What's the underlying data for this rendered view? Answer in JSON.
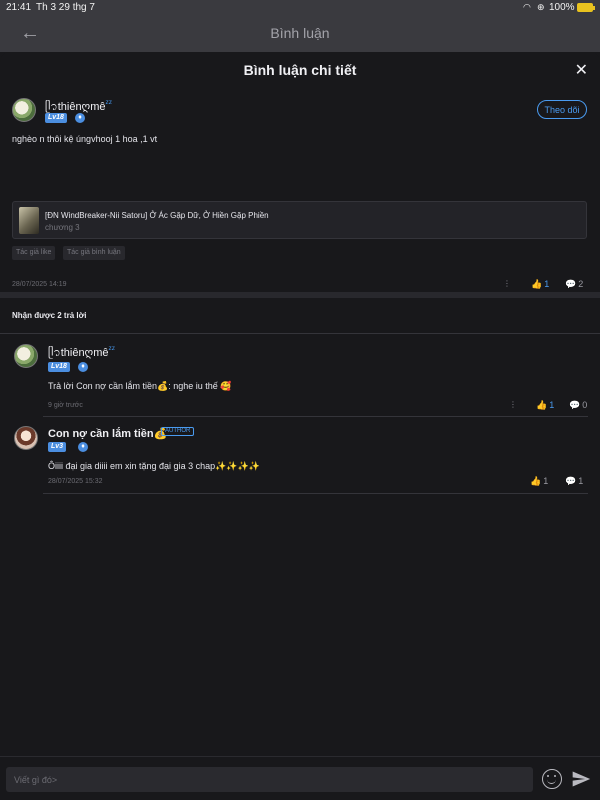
{
  "status_bar": {
    "time": "21:41",
    "date": "Th 3 29 thg 7",
    "battery": "100%"
  },
  "behind_header": {
    "title": "Bình luận"
  },
  "sheet": {
    "title": "Bình luận chi tiết"
  },
  "main_comment": {
    "username": "ᥫ᭡thiênღmê",
    "username_suffix": "ᶻᶻ",
    "level": "Lv18",
    "follow_label": "Theo dõi",
    "text": "nghèo n thôi kệ úngvhooj 1 hoa ,1 vt",
    "story": {
      "title": "[ĐN WindBreaker-Nii Satoru] Ở Ác Gặp Dữ, Ở Hiền Gặp Phiền",
      "chapter": "chương 3"
    },
    "tags": [
      "Tác giả like",
      "Tác giả bình luận"
    ],
    "timestamp": "28/07/2025 14:19",
    "likes": "1",
    "comments": "2"
  },
  "replies": {
    "heading": "Nhận được 2 trả lời",
    "items": [
      {
        "username": "ᥫ᭡thiênღmê",
        "username_suffix": "ᶻᶻ",
        "level": "Lv18",
        "text": "Trả lời Con nợ cần lắm tiền💰: nghe iu thế 🥰",
        "timestamp": "9 giờ trước",
        "likes": "1",
        "comments": "0"
      },
      {
        "username": "Con nợ cần lắm tiền💰",
        "author_badge": "AUTHOR",
        "level": "Lv3",
        "text": "Ôiiii đại gia diiii em xin tặng đại gia 3 chap✨✨✨✨",
        "timestamp": "28/07/2025 15:32",
        "likes": "1",
        "comments": "1"
      }
    ]
  },
  "input": {
    "placeholder": "Viết gì đó>"
  },
  "colors": {
    "accent": "#4a9bf0",
    "background": "#18181b",
    "level_badge": "#4b8ee0"
  }
}
